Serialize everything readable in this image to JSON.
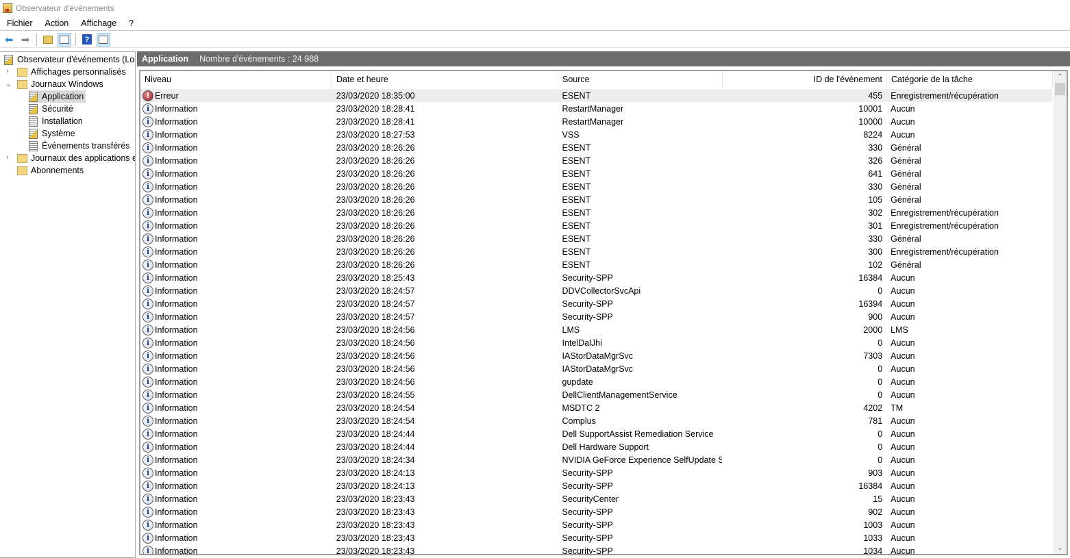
{
  "window": {
    "title": "Observateur d'événements"
  },
  "menu": [
    "Fichier",
    "Action",
    "Affichage",
    "?"
  ],
  "toolbar": {
    "icons": [
      "back-arrow-icon",
      "forward-arrow-icon",
      "up-folder-icon",
      "show-hide-tree-icon",
      "help-icon",
      "show-hide-actions-icon"
    ]
  },
  "tree": {
    "root": "Observateur d'événements (Local)",
    "custom_views": "Affichages personnalisés",
    "windows_logs": "Journaux Windows",
    "logs": [
      "Application",
      "Sécurité",
      "Installation",
      "Système",
      "Événements transférés"
    ],
    "app_logs": "Journaux des applications et des services",
    "subscriptions": "Abonnements"
  },
  "panel": {
    "title": "Application",
    "count": "Nombre d'événements : 24 988"
  },
  "columns": [
    "Niveau",
    "Date et heure",
    "Source",
    "ID de l'événement",
    "Catégorie de la tâche"
  ],
  "rows": [
    [
      "Erreur",
      "23/03/2020 18:35:00",
      "ESENT",
      "455",
      "Enregistrement/récupération"
    ],
    [
      "Information",
      "23/03/2020 18:28:41",
      "RestartManager",
      "10001",
      "Aucun"
    ],
    [
      "Information",
      "23/03/2020 18:28:41",
      "RestartManager",
      "10000",
      "Aucun"
    ],
    [
      "Information",
      "23/03/2020 18:27:53",
      "VSS",
      "8224",
      "Aucun"
    ],
    [
      "Information",
      "23/03/2020 18:26:26",
      "ESENT",
      "330",
      "Général"
    ],
    [
      "Information",
      "23/03/2020 18:26:26",
      "ESENT",
      "326",
      "Général"
    ],
    [
      "Information",
      "23/03/2020 18:26:26",
      "ESENT",
      "641",
      "Général"
    ],
    [
      "Information",
      "23/03/2020 18:26:26",
      "ESENT",
      "330",
      "Général"
    ],
    [
      "Information",
      "23/03/2020 18:26:26",
      "ESENT",
      "105",
      "Général"
    ],
    [
      "Information",
      "23/03/2020 18:26:26",
      "ESENT",
      "302",
      "Enregistrement/récupération"
    ],
    [
      "Information",
      "23/03/2020 18:26:26",
      "ESENT",
      "301",
      "Enregistrement/récupération"
    ],
    [
      "Information",
      "23/03/2020 18:26:26",
      "ESENT",
      "330",
      "Général"
    ],
    [
      "Information",
      "23/03/2020 18:26:26",
      "ESENT",
      "300",
      "Enregistrement/récupération"
    ],
    [
      "Information",
      "23/03/2020 18:26:26",
      "ESENT",
      "102",
      "Général"
    ],
    [
      "Information",
      "23/03/2020 18:25:43",
      "Security-SPP",
      "16384",
      "Aucun"
    ],
    [
      "Information",
      "23/03/2020 18:24:57",
      "DDVCollectorSvcApi",
      "0",
      "Aucun"
    ],
    [
      "Information",
      "23/03/2020 18:24:57",
      "Security-SPP",
      "16394",
      "Aucun"
    ],
    [
      "Information",
      "23/03/2020 18:24:57",
      "Security-SPP",
      "900",
      "Aucun"
    ],
    [
      "Information",
      "23/03/2020 18:24:56",
      "LMS",
      "2000",
      "LMS"
    ],
    [
      "Information",
      "23/03/2020 18:24:56",
      "IntelDalJhi",
      "0",
      "Aucun"
    ],
    [
      "Information",
      "23/03/2020 18:24:56",
      "IAStorDataMgrSvc",
      "7303",
      "Aucun"
    ],
    [
      "Information",
      "23/03/2020 18:24:56",
      "IAStorDataMgrSvc",
      "0",
      "Aucun"
    ],
    [
      "Information",
      "23/03/2020 18:24:56",
      "gupdate",
      "0",
      "Aucun"
    ],
    [
      "Information",
      "23/03/2020 18:24:55",
      "DellClientManagementService",
      "0",
      "Aucun"
    ],
    [
      "Information",
      "23/03/2020 18:24:54",
      "MSDTC 2",
      "4202",
      "TM"
    ],
    [
      "Information",
      "23/03/2020 18:24:54",
      "Complus",
      "781",
      "Aucun"
    ],
    [
      "Information",
      "23/03/2020 18:24:44",
      "Dell SupportAssist Remediation Service",
      "0",
      "Aucun"
    ],
    [
      "Information",
      "23/03/2020 18:24:44",
      "Dell Hardware Support",
      "0",
      "Aucun"
    ],
    [
      "Information",
      "23/03/2020 18:24:34",
      "NVIDIA GeForce Experience SelfUpdate S...",
      "0",
      "Aucun"
    ],
    [
      "Information",
      "23/03/2020 18:24:13",
      "Security-SPP",
      "903",
      "Aucun"
    ],
    [
      "Information",
      "23/03/2020 18:24:13",
      "Security-SPP",
      "16384",
      "Aucun"
    ],
    [
      "Information",
      "23/03/2020 18:23:43",
      "SecurityCenter",
      "15",
      "Aucun"
    ],
    [
      "Information",
      "23/03/2020 18:23:43",
      "Security-SPP",
      "902",
      "Aucun"
    ],
    [
      "Information",
      "23/03/2020 18:23:43",
      "Security-SPP",
      "1003",
      "Aucun"
    ],
    [
      "Information",
      "23/03/2020 18:23:43",
      "Security-SPP",
      "1033",
      "Aucun"
    ],
    [
      "Information",
      "23/03/2020 18:23:43",
      "Security-SPP",
      "1034",
      "Aucun"
    ]
  ]
}
